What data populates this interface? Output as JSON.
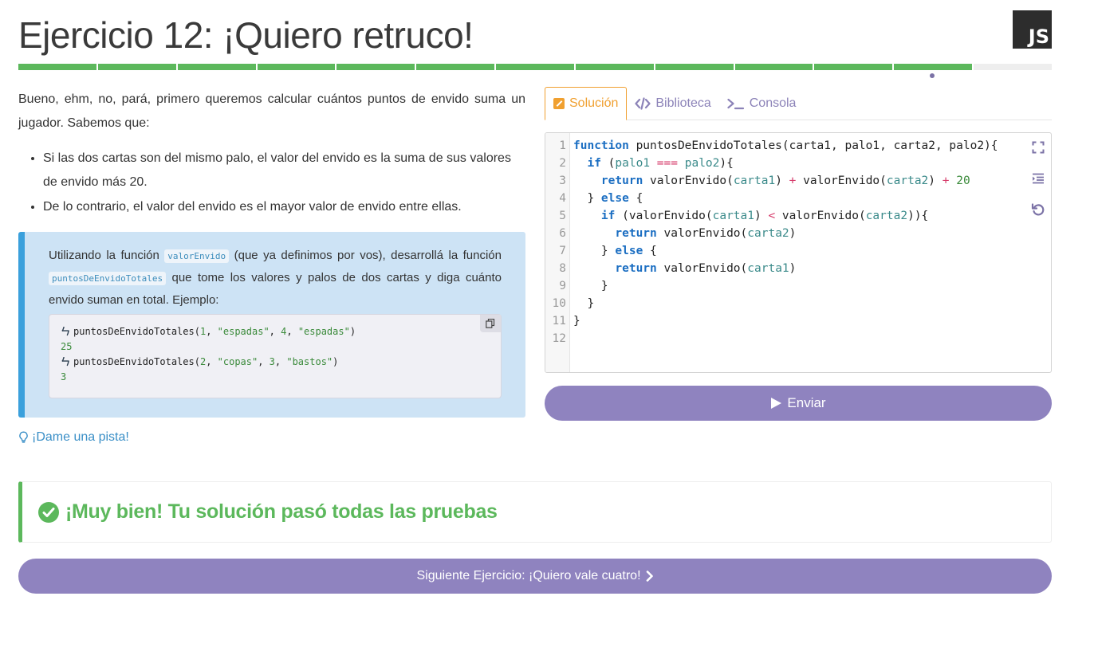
{
  "header": {
    "title": "Ejercicio 12: ¡Quiero retruco!",
    "language_badge": "JS"
  },
  "progress": {
    "total_segments": 13,
    "completed_segments": 12,
    "current_segment": 12
  },
  "statement": {
    "intro": "Bueno, ehm, no, pará, primero queremos calcular cuántos puntos de envido suma un jugador. Sabemos que:",
    "rules": [
      "Si las dos cartas son del mismo palo, el valor del envido es la suma de sus valores de envido más 20.",
      "De lo contrario, el valor del envido es el mayor valor de envido entre ellas."
    ]
  },
  "task": {
    "text_1": "Utilizando la función ",
    "code_1": "valorEnvido",
    "text_2": " (que ya definimos por vos), desarrollá la función ",
    "code_2": "puntosDeEnvidoTotales",
    "text_3": " que tome los valores y palos de dos cartas y diga cuánto envido suman en total. Ejemplo:",
    "example": {
      "call_1_fn": "puntosDeEnvidoTotales(",
      "call_1_a1": "1",
      "call_1_a2": "\"espadas\"",
      "call_1_a3": "4",
      "call_1_a4": "\"espadas\"",
      "result_1": "25",
      "call_2_fn": "puntosDeEnvidoTotales(",
      "call_2_a1": "2",
      "call_2_a2": "\"copas\"",
      "call_2_a3": "3",
      "call_2_a4": "\"bastos\"",
      "result_2": "3"
    }
  },
  "hint": {
    "label": "¡Dame una pista!"
  },
  "tabs": [
    {
      "label": "Solución",
      "icon": "edit-icon",
      "active": true
    },
    {
      "label": "Biblioteca",
      "icon": "code-icon",
      "active": false
    },
    {
      "label": "Consola",
      "icon": "terminal-icon",
      "active": false
    }
  ],
  "editor": {
    "line_numbers": [
      "1",
      "2",
      "3",
      "4",
      "5",
      "6",
      "7",
      "8",
      "9",
      "10",
      "11",
      "12"
    ]
  },
  "submit": {
    "label": "Enviar"
  },
  "result": {
    "message": "¡Muy bien! Tu solución pasó todas las pruebas"
  },
  "next": {
    "label": "Siguiente Ejercicio: ¡Quiero vale cuatro!"
  },
  "colors": {
    "success": "#5cb85c",
    "accent_purple": "#8f83bf",
    "active_tab": "#f0a030",
    "info_border": "#3aa0dc",
    "info_bg": "#cde3f5"
  }
}
